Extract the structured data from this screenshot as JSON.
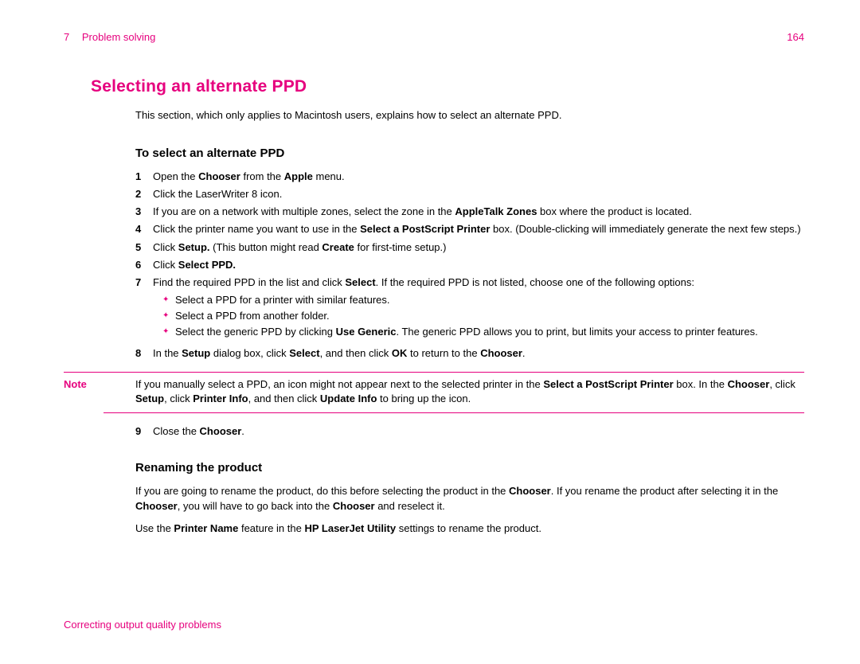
{
  "header": {
    "chapter_num": "7",
    "chapter_title": "Problem solving",
    "page_num": "164"
  },
  "h1": "Selecting an alternate PPD",
  "intro": "This section, which only applies to Macintosh users, explains how to select an alternate PPD.",
  "h2a": "To select an alternate PPD",
  "steps_a": {
    "1": {
      "pre": "Open the ",
      "b1": "Chooser",
      "mid": " from the ",
      "b2": "Apple",
      "post": " menu."
    },
    "2": "Click the LaserWriter 8 icon.",
    "3": {
      "pre": "If you are on a network with multiple zones, select the zone in the ",
      "b1": "AppleTalk Zones",
      "post": " box where the product is located."
    },
    "4": {
      "pre": "Click the printer name you want to use in the ",
      "b1": "Select a PostScript Printer",
      "post": " box. (Double-clicking will immediately generate the next few steps.)"
    },
    "5": {
      "pre": "Click ",
      "b1": "Setup.",
      "mid": " (This button might read ",
      "b2": "Create",
      "post": " for first-time setup.)"
    },
    "6": {
      "pre": "Click ",
      "b1": "Select PPD."
    },
    "7": {
      "pre": "Find the required PPD in the list and click ",
      "b1": "Select",
      "post": ". If the required PPD is not listed, choose one of the following options:"
    },
    "8": {
      "pre": "In the ",
      "b1": "Setup",
      "mid1": " dialog box, click ",
      "b2": "Select",
      "mid2": ", and then click ",
      "b3": "OK",
      "mid3": " to return to the ",
      "b4": "Chooser",
      "post": "."
    },
    "9": {
      "pre": "Close the ",
      "b1": "Chooser",
      "post": "."
    }
  },
  "bullets": {
    "a": "Select a PPD for a printer with similar features.",
    "b": "Select a PPD from another folder.",
    "c": {
      "pre": "Select the generic PPD by clicking ",
      "b1": "Use Generic",
      "post": ". The generic PPD allows you to print, but limits your access to printer features."
    }
  },
  "note": {
    "label": "Note",
    "pre": "If you manually select a PPD, an icon might not appear next to the selected printer in the ",
    "b1": "Select a PostScript Printer",
    "mid1": " box. In the ",
    "b2": "Chooser",
    "mid2": ", click ",
    "b3": "Setup",
    "mid3": ", click ",
    "b4": "Printer Info",
    "mid4": ", and then click ",
    "b5": "Update Info",
    "post": " to bring up the icon."
  },
  "h2b": "Renaming the product",
  "rename_p1": {
    "pre": "If you are going to rename the product, do this before selecting the product in the ",
    "b1": "Chooser",
    "mid1": ". If you rename the product after selecting it in the ",
    "b2": "Chooser",
    "mid2": ", you will have to go back into the ",
    "b3": "Chooser",
    "post": " and reselect it."
  },
  "rename_p2": {
    "pre": "Use the ",
    "b1": "Printer Name",
    "mid1": " feature in the ",
    "b2": "HP LaserJet Utility",
    "post": " settings to rename the product."
  },
  "footer": "Correcting output quality problems"
}
